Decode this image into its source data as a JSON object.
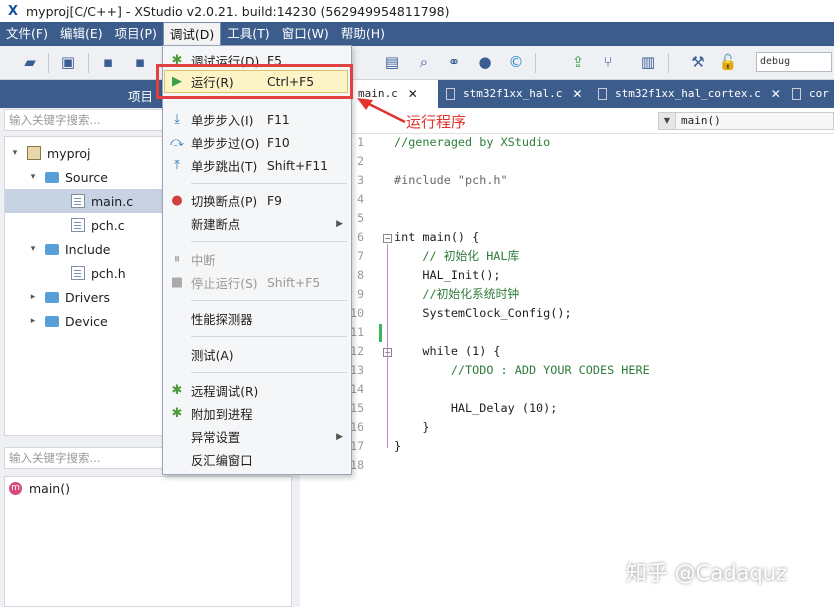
{
  "window": {
    "title": "myproj[C/C++] - XStudio v2.0.21. build:14230 (562949954811798)"
  },
  "menubar": [
    {
      "label": "文件(F)"
    },
    {
      "label": "编辑(E)"
    },
    {
      "label": "项目(P)"
    },
    {
      "label": "调试(D)"
    },
    {
      "label": "工具(T)"
    },
    {
      "label": "窗口(W)"
    },
    {
      "label": "帮助(H)"
    }
  ],
  "toolbar": {
    "config_value": "debug"
  },
  "left_panel": {
    "title": "项目",
    "search_placeholder": "输入关键字搜索...",
    "tree": [
      {
        "label": "myproj"
      },
      {
        "label": "Source"
      },
      {
        "label": "main.c"
      },
      {
        "label": "pch.c"
      },
      {
        "label": "Include"
      },
      {
        "label": "pch.h"
      },
      {
        "label": "Drivers"
      },
      {
        "label": "Device"
      }
    ],
    "outline_placeholder": "输入关键字搜索...",
    "outline_item": "main()",
    "outline_badge": "m"
  },
  "tabs": [
    {
      "label": "main.c"
    },
    {
      "label": "stm32f1xx_hal.c"
    },
    {
      "label": "stm32f1xx_hal_cortex.c"
    },
    {
      "label": "cor"
    }
  ],
  "editor": {
    "function_selector": "main()",
    "line_numbers": [
      "1",
      "2",
      "3",
      "4",
      "5",
      "6",
      "7",
      "8",
      "9",
      "10",
      "11",
      "12",
      "13",
      "14",
      "15",
      "16",
      "17",
      "18"
    ],
    "lines": [
      {
        "text": "//generaged by XStudio"
      },
      {
        "text": ""
      },
      {
        "text": "#include \"pch.h\""
      },
      {
        "text": ""
      },
      {
        "text": ""
      },
      {
        "text": "int main() {"
      },
      {
        "text": "    // 初始化 HAL库"
      },
      {
        "text": "    HAL_Init();"
      },
      {
        "text": "    //初始化系统时钟"
      },
      {
        "text": "    SystemClock_Config();"
      },
      {
        "text": ""
      },
      {
        "text": "    while (1) {"
      },
      {
        "text": "        //TODO : ADD YOUR CODES HERE"
      },
      {
        "text": ""
      },
      {
        "text": "        HAL_Delay (10);"
      },
      {
        "text": "    }"
      },
      {
        "text": "}"
      },
      {
        "text": ""
      }
    ]
  },
  "debug_menu": {
    "items": [
      {
        "label": "调试运行(D)",
        "shortcut": "F5"
      },
      {
        "label": "运行(R)",
        "shortcut": "Ctrl+F5"
      },
      {
        "label": "单步步入(I)",
        "shortcut": "F11"
      },
      {
        "label": "单步步过(O)",
        "shortcut": "F10"
      },
      {
        "label": "单步跳出(T)",
        "shortcut": "Shift+F11"
      },
      {
        "label": "切换断点(P)",
        "shortcut": "F9"
      },
      {
        "label": "新建断点",
        "shortcut": ""
      },
      {
        "label": "中断",
        "shortcut": ""
      },
      {
        "label": "停止运行(S)",
        "shortcut": "Shift+F5"
      },
      {
        "label": "性能探测器",
        "shortcut": ""
      },
      {
        "label": "测试(A)",
        "shortcut": ""
      },
      {
        "label": "远程调试(R)",
        "shortcut": ""
      },
      {
        "label": "附加到进程",
        "shortcut": ""
      },
      {
        "label": "异常设置",
        "shortcut": ""
      },
      {
        "label": "反汇编窗口",
        "shortcut": ""
      }
    ]
  },
  "annotation": {
    "text": "运行程序",
    "color": "#e0332c"
  },
  "watermark": {
    "text": "知乎 @Cadaquz"
  },
  "colors": {
    "menubar": "#3c5c8c",
    "selection": "#c7d2e2",
    "highlight": "#e04040"
  }
}
